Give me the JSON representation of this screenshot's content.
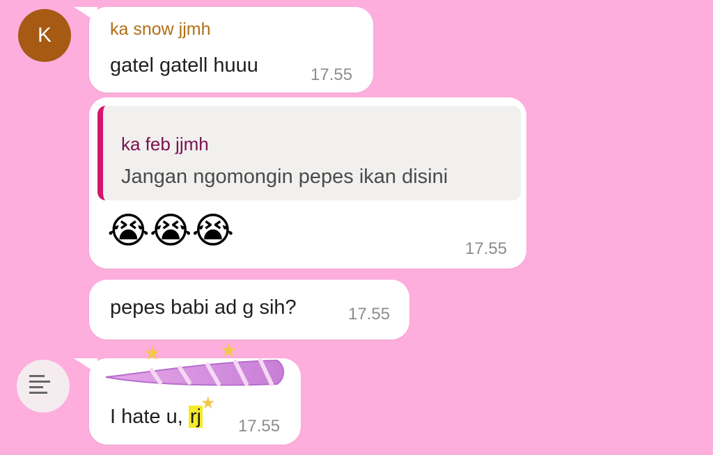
{
  "messages": [
    {
      "avatar_letter": "K",
      "sender": "ka snow jjmh",
      "text": "gatel gatell huuu",
      "time": "17.55"
    },
    {
      "quote_sender": "ka feb jjmh",
      "quote_text": "Jangan ngomongin pepes ikan disini",
      "emoji": "😭😭😭",
      "time": "17.55"
    },
    {
      "text": "pepes babi ad g sih?",
      "time": "17.55"
    },
    {
      "sender": "",
      "text": "I hate u, ",
      "highlighted": "rj",
      "time": "17.55"
    }
  ],
  "avatar2_icon": "sticker-thumbnail",
  "colors": {
    "background": "#fdaedd",
    "avatar_k": "#a65a13",
    "sender1": "#b06f12",
    "quote_bar": "#d4166a",
    "quote_name": "#7a1150",
    "sender4": "#ea1e4d",
    "timestamp": "#8c8c8c",
    "highlight": "#f4ea2a"
  }
}
